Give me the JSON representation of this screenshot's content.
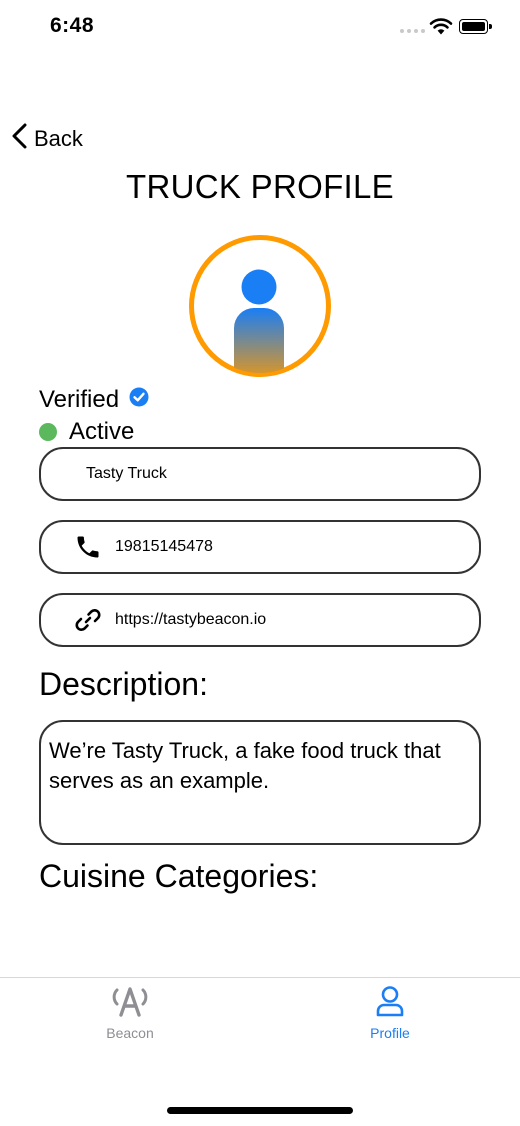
{
  "status_bar": {
    "time": "6:48"
  },
  "nav": {
    "back_label": "Back",
    "title": "TRUCK PROFILE"
  },
  "profile": {
    "avatar_icon": "person-gradient-icon",
    "verified_label": "Verified",
    "verified_icon": "checkmark-badge-icon",
    "active_label": "Active",
    "active_color": "#5cb85c"
  },
  "fields": {
    "name_value": "Tasty Truck",
    "phone_value": "19815145478",
    "phone_icon": "phone-icon",
    "website_value": "https://tastybeacon.io",
    "website_icon": "link-icon"
  },
  "description": {
    "heading": "Description:",
    "text": "We’re Tasty Truck, a fake food truck that serves as an example."
  },
  "cuisine": {
    "heading": "Cuisine Categories:"
  },
  "tab_bar": {
    "tabs": [
      {
        "label": "Beacon",
        "icon": "beacon-antenna-icon",
        "selected": false
      },
      {
        "label": "Profile",
        "icon": "person-icon",
        "selected": true
      }
    ],
    "accent_color": "#1a7ef5",
    "inactive_color": "#8e8e93"
  },
  "colors": {
    "avatar_ring": "#ff9a00",
    "avatar_gradient_top": "#1a7ef5",
    "avatar_gradient_bottom": "#ff9a00"
  }
}
